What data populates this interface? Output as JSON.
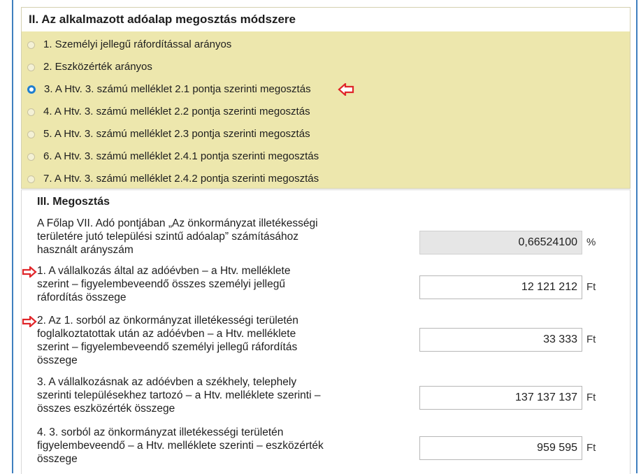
{
  "section2": {
    "title": "II. Az alkalmazott adóalap megosztás módszere",
    "options": [
      {
        "label": "1. Személyi jellegű ráfordítással arányos",
        "selected": false
      },
      {
        "label": "2. Eszközérték arányos",
        "selected": false
      },
      {
        "label": "3. A Htv. 3. számú melléklet 2.1 pontja szerinti megosztás",
        "selected": true
      },
      {
        "label": "4. A Htv. 3. számú melléklet 2.2 pontja szerinti megosztás",
        "selected": false
      },
      {
        "label": "5. A Htv. 3. számú melléklet 2.3 pontja szerinti megosztás",
        "selected": false
      },
      {
        "label": "6. A Htv. 3. számú melléklet 2.4.1 pontja szerinti megosztás",
        "selected": false
      },
      {
        "label": "7. A Htv. 3. számú melléklet 2.4.2 pontja szerinti megosztás",
        "selected": false
      }
    ]
  },
  "section3": {
    "title": "III. Megosztás",
    "rows": [
      {
        "lines": [
          "A Főlap VII. Adó pontjában „Az önkormányzat illetékességi",
          "területére jutó települési szintű adóalap” számításához",
          "használt arányszám"
        ],
        "value": "0,66524100",
        "unit": "%"
      },
      {
        "lines": [
          "1. A vállalkozás által az adóévben – a Htv. melléklete",
          "szerint – figyelembeveendő összes személyi jellegű",
          "ráfordítás összege"
        ],
        "value": "12 121 212",
        "unit": "Ft"
      },
      {
        "lines": [
          "2. Az 1. sorból az önkormányzat illetékességi területén",
          "foglalkoztatottak után az adóévben – a Htv. melléklete",
          "szerint – figyelembeveendő személyi jellegű ráfordítás",
          "összege"
        ],
        "value": "33 333",
        "unit": "Ft"
      },
      {
        "lines": [
          "3. A vállalkozásnak az adóévben a székhely, telephely",
          "szerinti településekhez tartozó – a Htv. melléklete szerinti –",
          "összes eszközérték összege"
        ],
        "value": "137 137 137",
        "unit": "Ft"
      },
      {
        "lines": [
          "4. 3. sorból az önkormányzat illetékességi területén",
          "figyelembeveendő – a Htv. melléklete szerinti – eszközérték",
          "összege"
        ],
        "value": "959 595",
        "unit": "Ft"
      }
    ]
  },
  "colors": {
    "accent": "#1f7fd0",
    "options_bg": "#ede7ad",
    "arrow": "#e0262a",
    "readonly_bg": "#e6e6e6"
  }
}
